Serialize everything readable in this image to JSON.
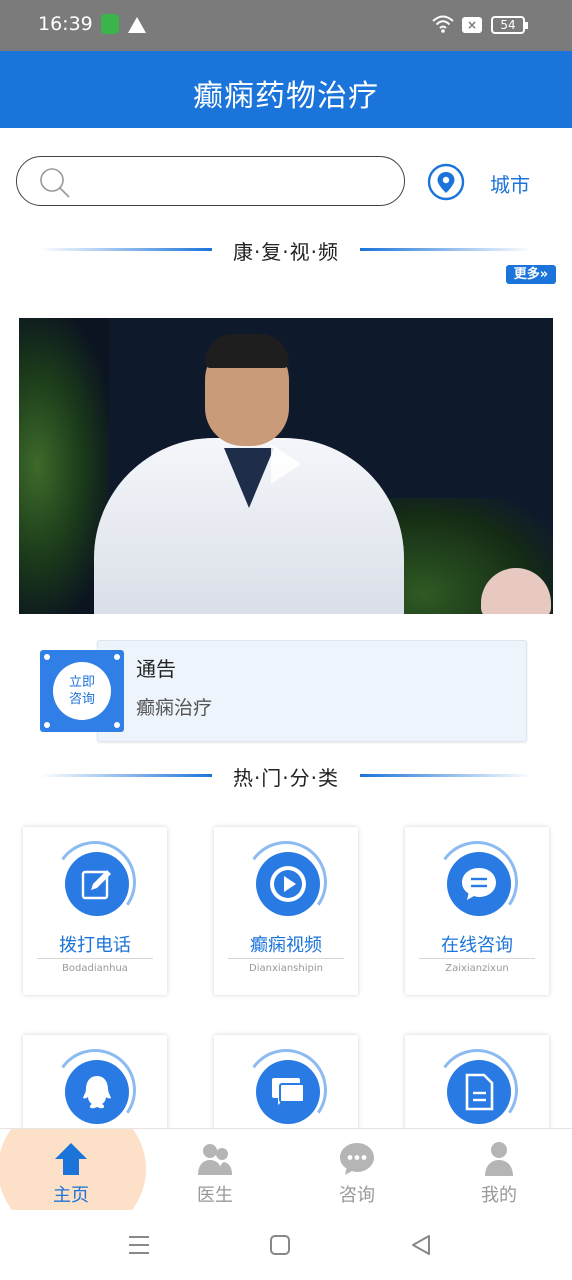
{
  "status": {
    "time": "16:39",
    "battery": "54"
  },
  "app": {
    "title": "癫痫药物治疗"
  },
  "search": {
    "placeholder": "",
    "city_label": "城市"
  },
  "sections": {
    "video_title": "康·复·视·频",
    "more_label": "更多»",
    "category_title": "热·门·分·类"
  },
  "notice": {
    "icon_text_1": "立即",
    "icon_text_2": "咨询",
    "title": "通告",
    "subtitle": "癫痫治疗"
  },
  "categories": [
    {
      "label": "拨打电话",
      "sub": "Bodadianhua",
      "icon": "edit-icon"
    },
    {
      "label": "癫痫视频",
      "sub": "Dianxianshipin",
      "icon": "play-icon"
    },
    {
      "label": "在线咨询",
      "sub": "Zaixianzixun",
      "icon": "chat-bubble-icon"
    },
    {
      "label": "",
      "sub": "",
      "icon": "qq-icon"
    },
    {
      "label": "",
      "sub": "",
      "icon": "message-icon"
    },
    {
      "label": "",
      "sub": "",
      "icon": "document-icon"
    }
  ],
  "tabs": [
    {
      "label": "主页",
      "icon": "home-icon",
      "active": true
    },
    {
      "label": "医生",
      "icon": "doctors-icon",
      "active": false
    },
    {
      "label": "咨询",
      "icon": "consult-icon",
      "active": false
    },
    {
      "label": "我的",
      "icon": "profile-icon",
      "active": false
    }
  ],
  "colors": {
    "primary": "#1b74d9",
    "tab_highlight": "#fde0c8"
  }
}
